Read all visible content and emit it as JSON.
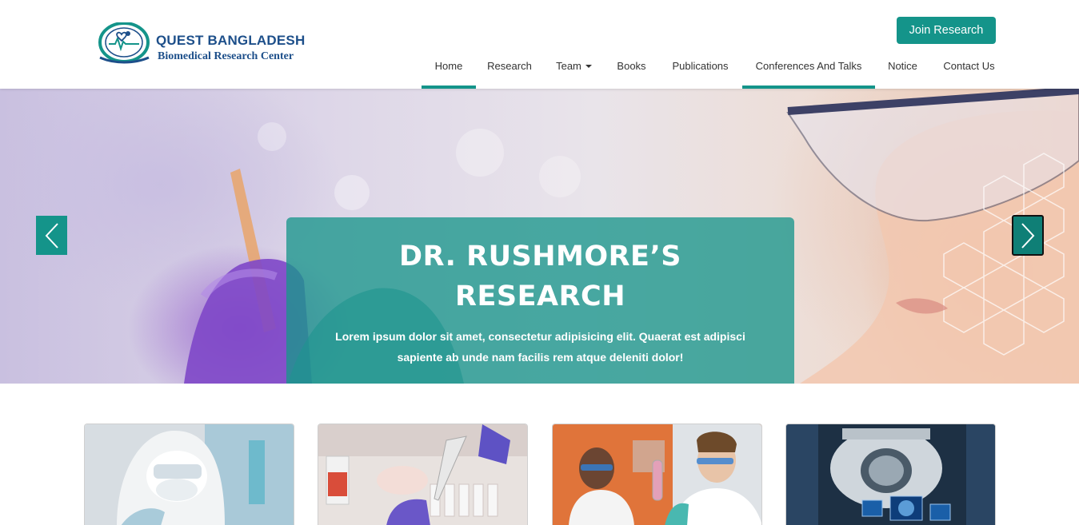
{
  "header": {
    "logo": {
      "title": "QUEST BANGLADESH",
      "subtitle": "Biomedical Research Center",
      "emblem_text": "Quest Bangladesh Biomedical Research Center"
    },
    "join_button": "Join Research",
    "nav": [
      {
        "label": "Home",
        "active": true
      },
      {
        "label": "Research",
        "active": false
      },
      {
        "label": "Team",
        "active": false,
        "dropdown": true
      },
      {
        "label": "Books",
        "active": false
      },
      {
        "label": "Publications",
        "active": false
      },
      {
        "label": "Conferences And Talks",
        "active": true
      },
      {
        "label": "Notice",
        "active": false
      },
      {
        "label": "Contact Us",
        "active": false
      }
    ]
  },
  "hero": {
    "title_line1": "DR. RUSHMORE’S",
    "title_line2": "RESEARCH",
    "text_line1": "Lorem ipsum dolor sit amet, consectetur adipisicing elit. Quaerat est adipisci",
    "text_line2": "sapiente ab unde nam facilis rem atque deleniti dolor!",
    "prev_icon": "chevron-left-icon",
    "next_icon": "chevron-right-icon"
  },
  "cards": [
    {
      "image": "scientist-in-protective-suit-photo"
    },
    {
      "image": "lab-pipette-samples-photo"
    },
    {
      "image": "two-researchers-with-test-tube-photo"
    },
    {
      "image": "mri-scanner-room-photo"
    }
  ],
  "colors": {
    "accent": "#14948a",
    "logo_blue": "#1d4f8a",
    "caption_bg": "rgba(26,150,140,0.78)"
  }
}
